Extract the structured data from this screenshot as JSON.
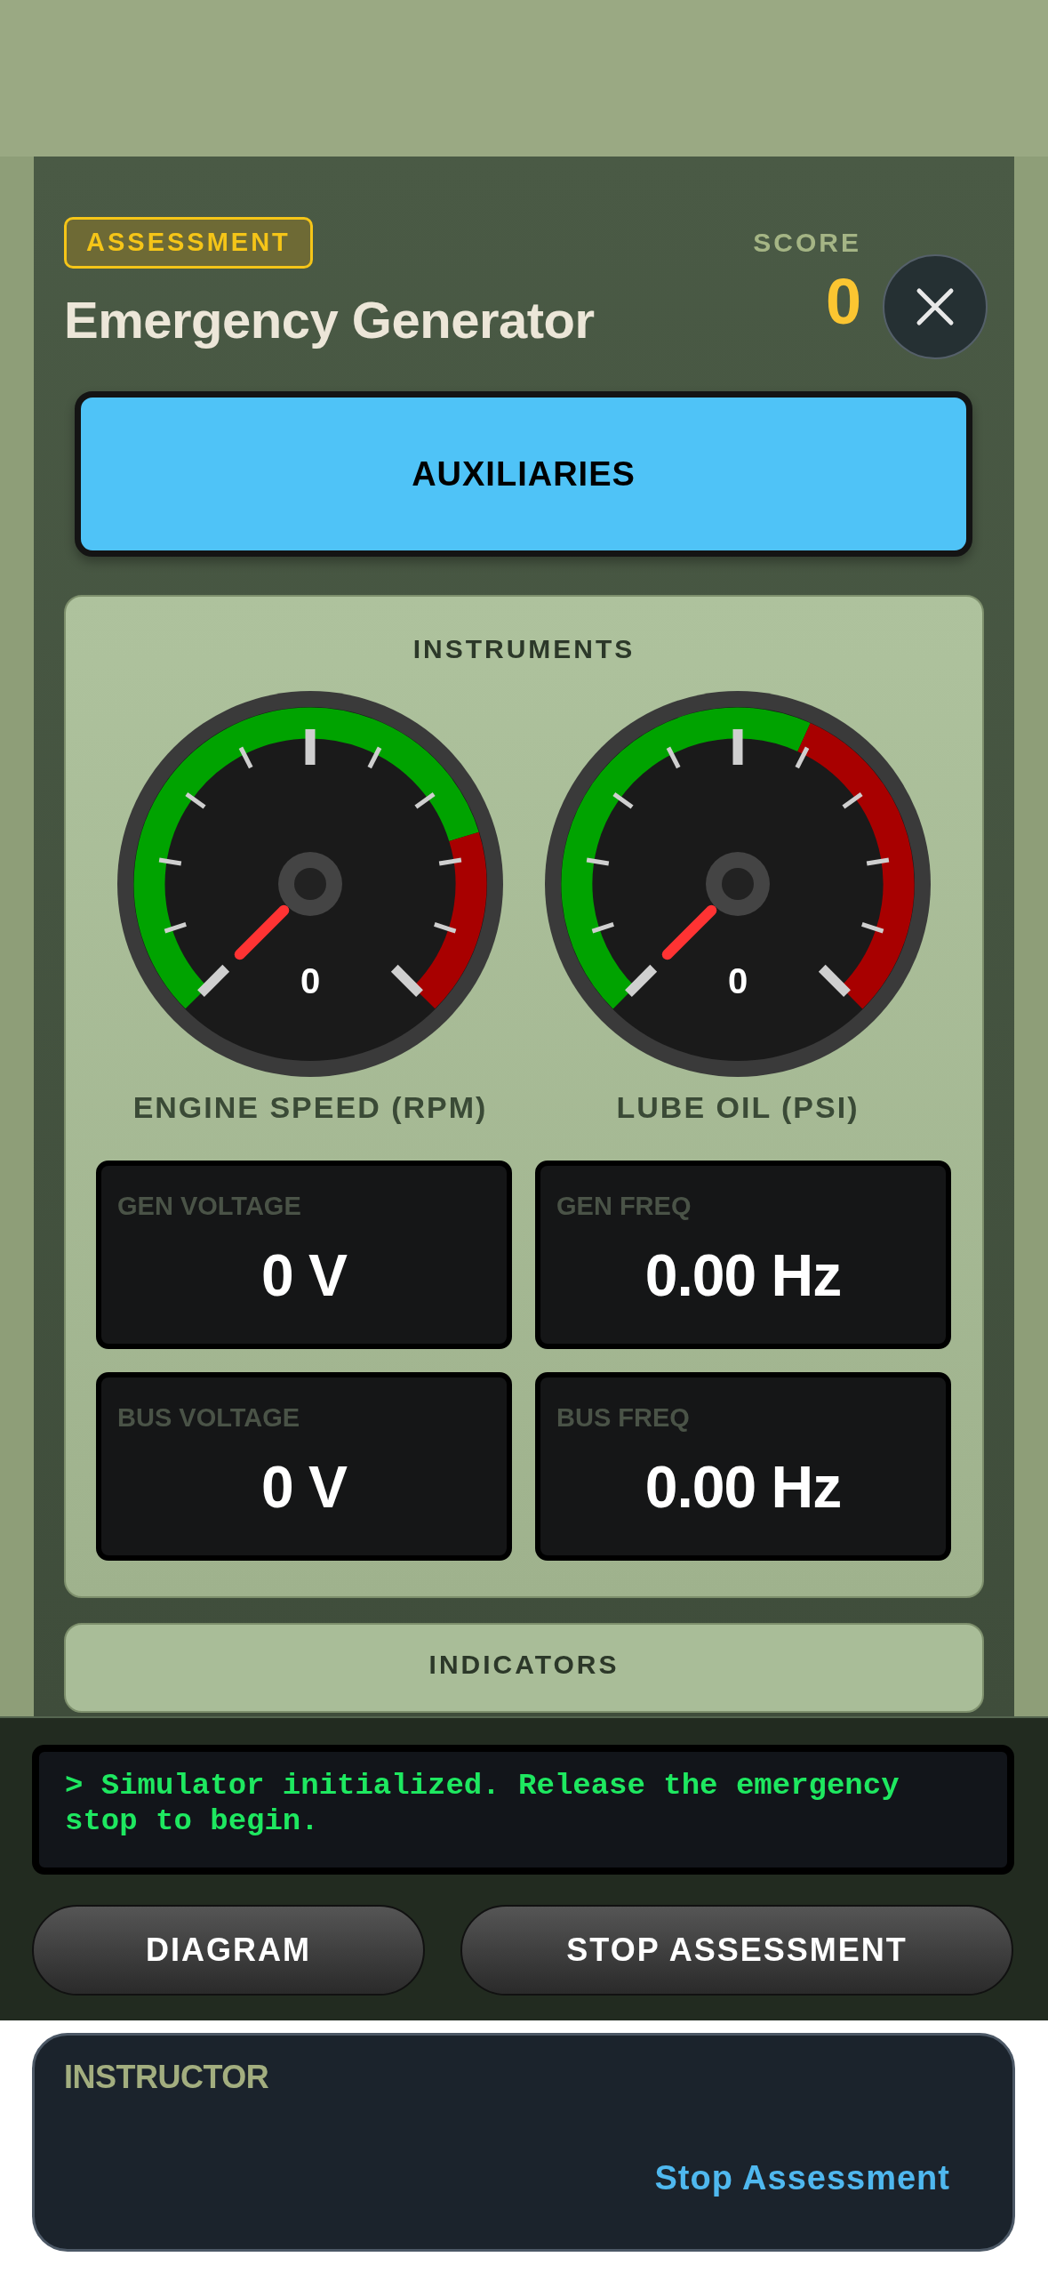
{
  "header": {
    "badge": "ASSESSMENT",
    "title": "Emergency Generator",
    "score_label": "SCORE",
    "score": "0"
  },
  "system_button": {
    "label": "AUXILIARIES"
  },
  "instruments": {
    "title": "INSTRUMENTS",
    "gauges": [
      {
        "kind": "rpm",
        "label": "ENGINE SPEED (RPM)",
        "reading": "0"
      },
      {
        "kind": "pressure",
        "label": "LUBE OIL (PSI)",
        "reading": "0"
      }
    ],
    "readouts": [
      {
        "label": "GEN VOLTAGE",
        "value": "0 V"
      },
      {
        "label": "GEN FREQ",
        "value": "0.00 Hz"
      },
      {
        "label": "BUS VOLTAGE",
        "value": "0 V"
      },
      {
        "label": "BUS FREQ",
        "value": "0.00 Hz"
      }
    ]
  },
  "indicators": {
    "title": "INDICATORS"
  },
  "console": {
    "message": "> Simulator initialized. Release the emergency stop to begin."
  },
  "buttons": [
    "DIAGRAM",
    "STOP ASSESSMENT"
  ],
  "instructor": {
    "title": "INSTRUCTOR",
    "link": "Stop Assessment"
  }
}
